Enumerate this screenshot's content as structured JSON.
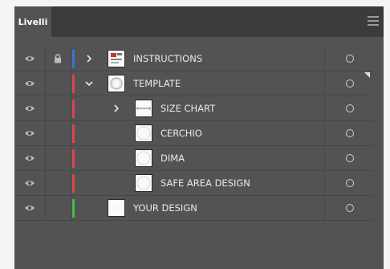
{
  "panel": {
    "tab_label": "Livelli"
  },
  "colors": {
    "blue": "#3f6fd8",
    "red": "#e0434a",
    "green": "#40bf4a"
  },
  "layers": [
    {
      "name": "INSTRUCTIONS",
      "indent": 0,
      "expander": "collapsed",
      "locked": true,
      "color": "blue",
      "thumb": "instructions"
    },
    {
      "name": "TEMPLATE",
      "indent": 0,
      "expander": "expanded",
      "locked": false,
      "color": "red",
      "thumb": "template"
    },
    {
      "name": "SIZE CHART",
      "indent": 1,
      "expander": "collapsed",
      "locked": false,
      "color": "red",
      "thumb": "sizechart"
    },
    {
      "name": "CERCHIO",
      "indent": 1,
      "expander": "none",
      "locked": false,
      "color": "red",
      "thumb": "circle"
    },
    {
      "name": "DIMA",
      "indent": 1,
      "expander": "none",
      "locked": false,
      "color": "red",
      "thumb": "circle"
    },
    {
      "name": "SAFE AREA DESIGN",
      "indent": 1,
      "expander": "none",
      "locked": false,
      "color": "red",
      "thumb": "circle"
    },
    {
      "name": "YOUR DESIGN",
      "indent": 0,
      "expander": "none",
      "locked": false,
      "color": "green",
      "thumb": "blank"
    }
  ]
}
